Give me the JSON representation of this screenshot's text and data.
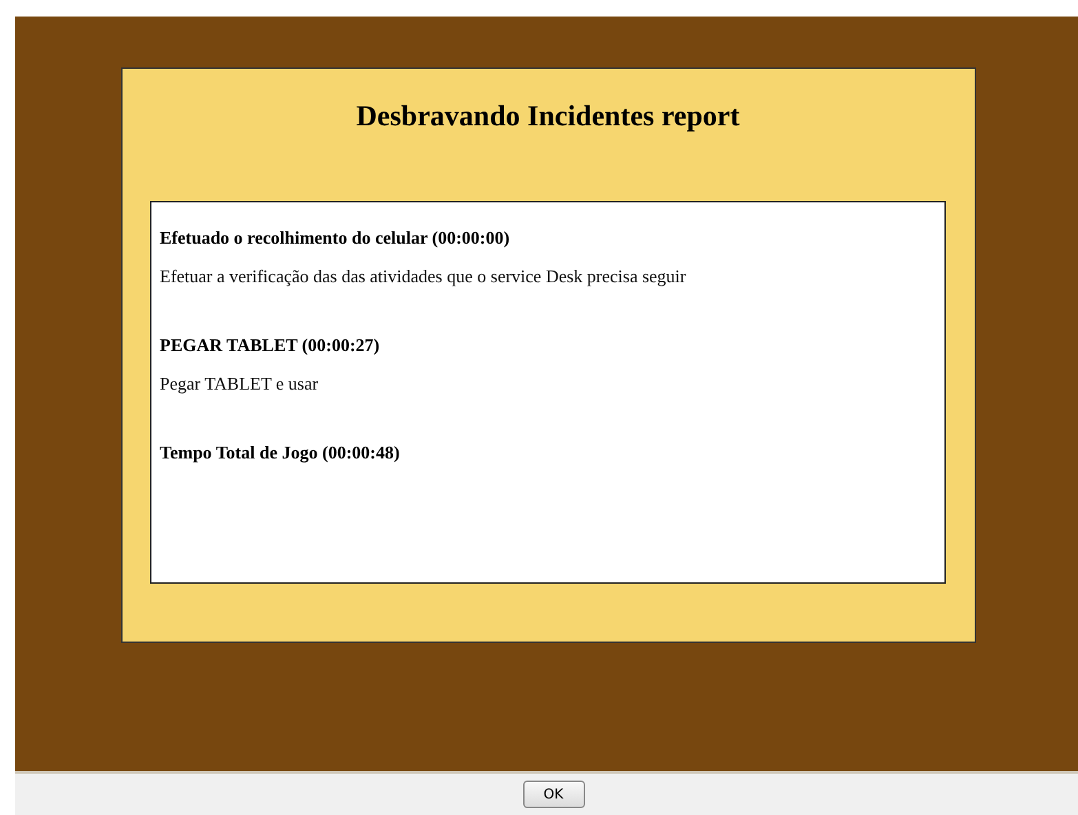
{
  "report": {
    "title": "Desbravando Incidentes report",
    "entries": [
      {
        "heading": "Efetuado o recolhimento do celular (00:00:00)",
        "description": "Efetuar a verificação das das atividades que o service Desk precisa seguir"
      },
      {
        "heading": "PEGAR TABLET (00:00:27)",
        "description": "Pegar TABLET e usar"
      },
      {
        "heading": "Tempo Total de Jogo (00:00:48)"
      }
    ]
  },
  "buttons": [
    "OK"
  ]
}
